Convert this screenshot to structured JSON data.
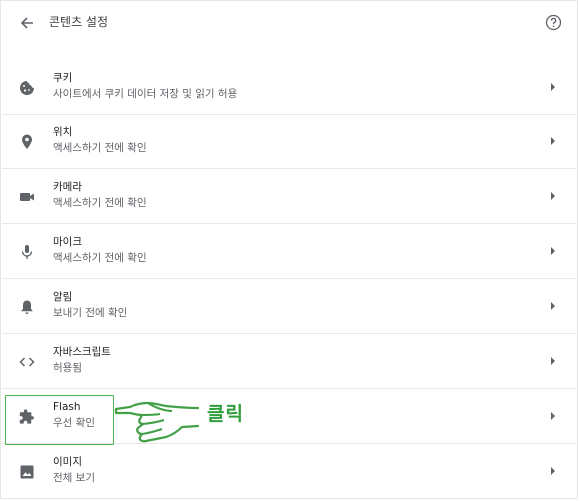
{
  "header": {
    "title": "콘텐츠 설정",
    "back_icon": "arrow-left-icon",
    "help_icon": "help-circle-icon"
  },
  "rows": [
    {
      "label": "쿠키",
      "sub": "사이트에서 쿠키 데이터 저장 및 읽기 허용",
      "icon": "cookie-icon"
    },
    {
      "label": "위치",
      "sub": "액세스하기 전에 확인",
      "icon": "location-pin-icon"
    },
    {
      "label": "카메라",
      "sub": "액세스하기 전에 확인",
      "icon": "camera-icon"
    },
    {
      "label": "마이크",
      "sub": "액세스하기 전에 확인",
      "icon": "microphone-icon"
    },
    {
      "label": "알림",
      "sub": "보내기 전에 확인",
      "icon": "bell-icon"
    },
    {
      "label": "자바스크립트",
      "sub": "허용됨",
      "icon": "code-icon"
    },
    {
      "label": "Flash",
      "sub": "우선 확인",
      "icon": "puzzle-icon"
    },
    {
      "label": "이미지",
      "sub": "전체 보기",
      "icon": "image-icon"
    }
  ],
  "annotation": {
    "text": "클릭",
    "color": "#2f9e3c",
    "hand_icon": "pointing-hand-icon"
  }
}
